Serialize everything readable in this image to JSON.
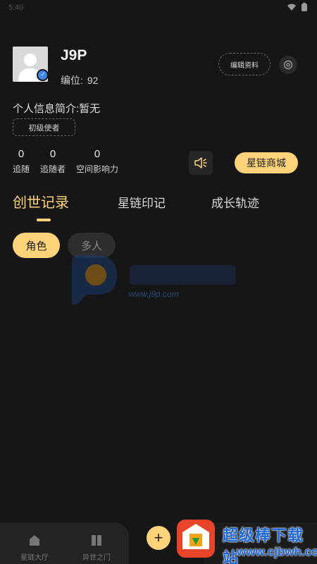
{
  "status_bar": {
    "time": "5:40",
    "icons": [
      "wifi-icon",
      "battery-icon"
    ]
  },
  "profile": {
    "username": "J9P",
    "id_label": "编位:",
    "id_value": "92",
    "edit_label": "编辑资料",
    "bio": "个人信息简介:暂无",
    "rank": "初级使者",
    "gender": "male"
  },
  "stats": [
    {
      "value": "0",
      "label": "追随"
    },
    {
      "value": "0",
      "label": "追随者"
    },
    {
      "value": "0",
      "label": "空间影响力"
    }
  ],
  "shop_label": "星链商城",
  "tabs": [
    {
      "label": "创世记录",
      "active": true
    },
    {
      "label": "星链印记",
      "active": false
    },
    {
      "label": "成长轨迹",
      "active": false
    }
  ],
  "filters": [
    {
      "label": "角色",
      "active": true
    },
    {
      "label": "多人",
      "active": false
    }
  ],
  "watermark": {
    "domain": "www.j9p.com"
  },
  "bottom_nav": [
    {
      "label": "星链大厅",
      "icon": "home-icon"
    },
    {
      "label": "异世之门",
      "icon": "gate-icon"
    }
  ],
  "site_overlay": {
    "name": "超级棒下载站",
    "url": "www.cjbwh.com"
  },
  "colors": {
    "accent": "#ffd37a",
    "background": "#161616",
    "gender_badge": "#3b86e6"
  }
}
